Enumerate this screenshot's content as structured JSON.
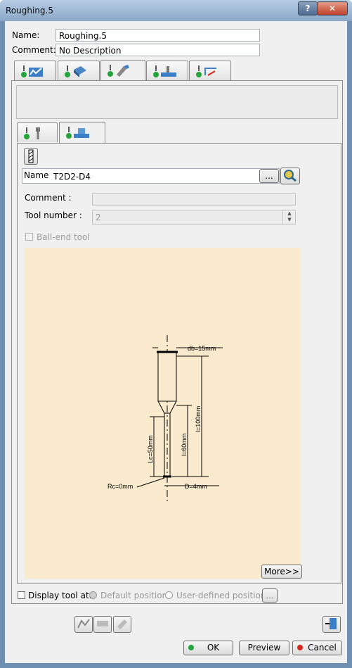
{
  "window": {
    "title": "Roughing.5"
  },
  "header": {
    "name_label": "Name:",
    "name_value": "Roughing.5",
    "comment_label": "Comment:",
    "comment_value": "No Description"
  },
  "tool_page": {
    "name_label": "Name",
    "name_value": "T2D2-D4",
    "browse_label": "...",
    "comment_label": "Comment :",
    "comment_value": "",
    "tool_number_label": "Tool number :",
    "tool_number_value": "2",
    "ball_end_label": "Ball-end tool",
    "more_label": "More>>"
  },
  "drawing": {
    "db": "db=15mm",
    "l_total": "l=100mm",
    "lc": "Lc=50mm",
    "l_shank": "l=60mm",
    "rc": "Rc=0mm",
    "d": "D=4mm"
  },
  "display": {
    "label": "Display tool at:",
    "default_label": "Default position",
    "user_label": "User-defined position",
    "browse_label": "..."
  },
  "footer": {
    "ok_label": "OK",
    "preview_label": "Preview",
    "cancel_label": "Cancel"
  },
  "colors": {
    "accent_green": "#22a53a",
    "cancel_red": "#d6261d",
    "drawing_bg": "#fbebce"
  }
}
